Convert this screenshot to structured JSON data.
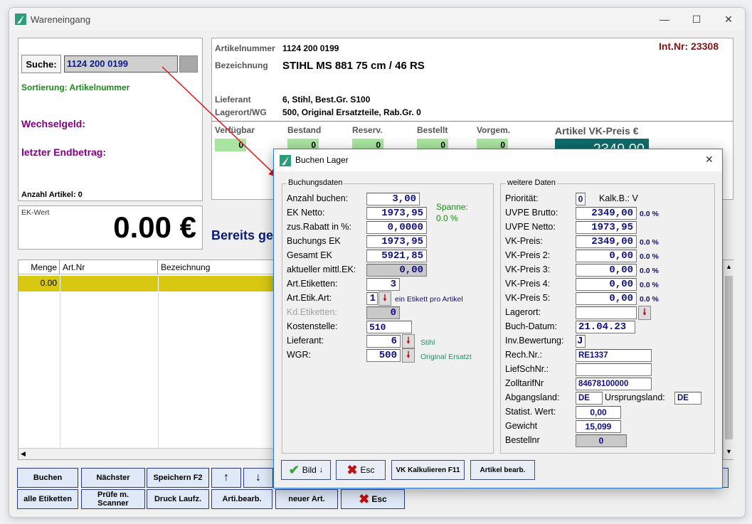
{
  "window": {
    "title": "Wareneingang",
    "minimize": "—",
    "maximize": "☐",
    "close": "✕"
  },
  "search": {
    "label": "Suche:",
    "value": "1124 200 0199",
    "sort_text": "Sortierung: Artikelnummer"
  },
  "left_info": {
    "change_label": "Wechselgeld:",
    "last_total_label": "letzter Endbetrag:",
    "count_label": "Anzahl Artikel: 0"
  },
  "ek_panel": {
    "label": "EK-Wert",
    "value": "0.00 €"
  },
  "bereits_text": "Bereits ge",
  "article": {
    "int_nr": "Int.Nr: 23308",
    "nr_label": "Artikelnummer",
    "nr": "1124 200 0199",
    "desc_label": "Bezeichnung",
    "desc": "STIHL MS 881 75 cm / 46 RS",
    "supplier_label": "Lieferant",
    "supplier": "6, Stihl, Best.Gr. S100",
    "location_label": "Lagerort/WG",
    "location": "500, Original Ersatzteile, Rab.Gr. 0"
  },
  "stock": {
    "available_label": "Verfügbar",
    "available": "0",
    "stock_label": "Bestand",
    "stock": "0",
    "reserved_label": "Reserv.",
    "reserved": "0",
    "ordered_label": "Bestellt",
    "ordered": "0",
    "marked_label": "Vorgem.",
    "marked": "0",
    "price_label": "Artikel VK-Preis €",
    "price": "2349.00"
  },
  "grid": {
    "col_qty": "Menge",
    "col_art": "Art.Nr",
    "col_desc": "Bezeichnung",
    "row_qty": "0.00"
  },
  "bottom_buttons": {
    "buchen": "Buchen",
    "naechster": "Nächster",
    "speichern": "Speichern F2",
    "alle_etiketten": "alle Etiketten",
    "pruefe": "Prüfe m. Scanner",
    "druck": "Druck Laufz.",
    "arti_bearb": "Arti.bearb.",
    "neuer_art": "neuer Art.",
    "esc": "Esc"
  },
  "dialog": {
    "title": "Buchen Lager",
    "close": "✕",
    "group_left": "Buchungsdaten",
    "group_right": "weitere Daten",
    "fields_left": {
      "anzahl_label": "Anzahl buchen:",
      "anzahl": "3,00",
      "ek_netto_label": "EK Netto:",
      "ek_netto": "1973,95",
      "rabatt_label": "zus.Rabatt in %:",
      "rabatt": "0,0000",
      "buchungs_ek_label": "Buchungs EK",
      "buchungs_ek": "1973,95",
      "gesamt_ek_label": "Gesamt EK",
      "gesamt_ek": "5921,85",
      "mittl_ek_label": "aktueller mittl.EK:",
      "mittl_ek": "0,00",
      "art_etiketten_label": "Art.Etiketten:",
      "art_etiketten": "3",
      "etik_art_label": "Art.Etik.Art:",
      "etik_art": "1",
      "etik_art_hint": "ein Etikett pro Artikel",
      "kd_etiketten_label": "Kd.Etiketten:",
      "kd_etiketten": "0",
      "kostenstelle_label": "Kostenstelle:",
      "kostenstelle": "510",
      "lieferant_label": "Lieferant:",
      "lieferant": "6",
      "lieferant_hint": "Stihl",
      "wgr_label": "WGR:",
      "wgr": "500",
      "wgr_hint": "Original Ersatzt",
      "spanne_label": "Spanne:",
      "spanne": "0.0 %"
    },
    "fields_right": {
      "prioritaet_label": "Priorität:",
      "prioritaet": "0",
      "kalk_label": "Kalk.B.: V",
      "uvpe_brutto_label": "UVPE Brutto:",
      "uvpe_brutto": "2349,00",
      "uvpe_brutto_pct": "0.0 %",
      "uvpe_netto_label": "UVPE Netto:",
      "uvpe_netto": "1973,95",
      "vk1_label": "VK-Preis:",
      "vk1": "2349,00",
      "vk1_pct": "0.0 %",
      "vk2_label": "VK-Preis 2:",
      "vk2": "0,00",
      "vk2_pct": "0.0 %",
      "vk3_label": "VK-Preis 3:",
      "vk3": "0,00",
      "vk3_pct": "0.0 %",
      "vk4_label": "VK-Preis 4:",
      "vk4": "0,00",
      "vk4_pct": "0.0 %",
      "vk5_label": "VK-Preis 5:",
      "vk5": "0,00",
      "vk5_pct": "0.0 %",
      "lagerort_label": "Lagerort:",
      "lagerort": "",
      "buch_datum_label": "Buch-Datum:",
      "buch_datum": "21.04.23",
      "inv_label": "Inv.Bewertung:",
      "inv": "J",
      "rech_label": "Rech.Nr.:",
      "rech": "RE1337",
      "liefschein_label": "LiefSchNr.:",
      "liefschein": "",
      "zoll_label": "ZolltarifNr",
      "zoll": "84678100000",
      "abgang_label": "Abgangsland:",
      "abgang": "DE",
      "ursprung_label": "Ursprungsland:",
      "ursprung": "DE",
      "statist_label": "Statist. Wert:",
      "statist": "0,00",
      "gewicht_label": "Gewicht",
      "gewicht": "15,099",
      "bestellnr_label": "Bestellnr",
      "bestellnr": "0"
    },
    "buttons": {
      "bild": "Bild",
      "esc": "Esc",
      "vk_kalk": "VK Kalkulieren F11",
      "artikel_bearb": "Artikel bearb."
    }
  },
  "colors": {
    "accent_green": "#a9e5a0",
    "price_box": "#0f6b6b",
    "purple_label": "#800080",
    "row_highlight": "#d8c812",
    "red_arrow": "#e01818"
  }
}
